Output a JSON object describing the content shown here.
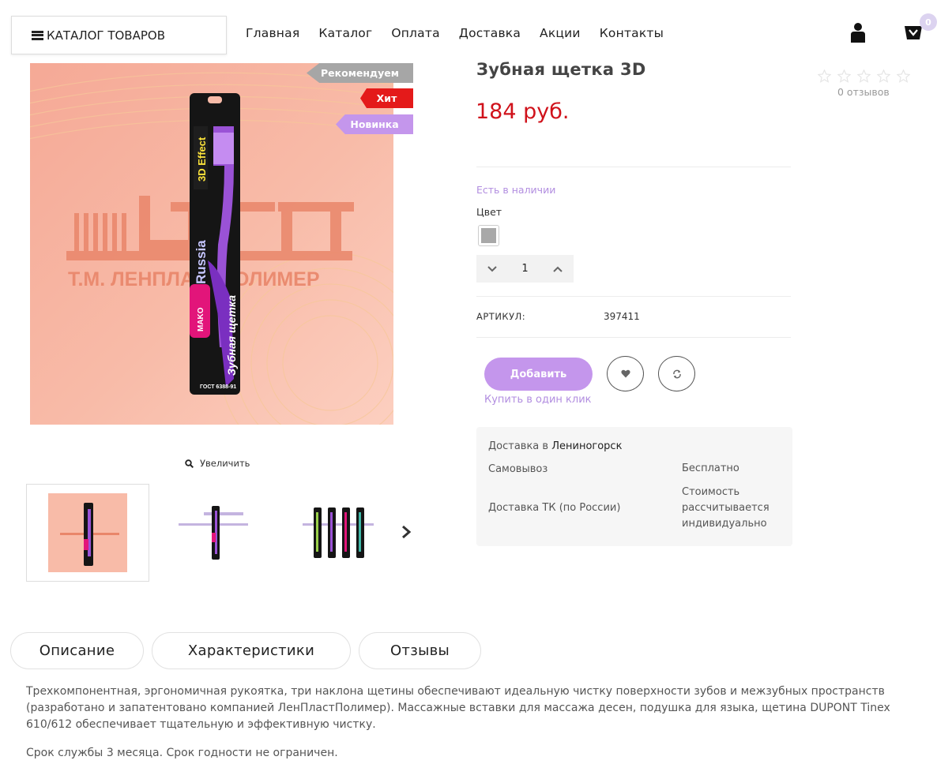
{
  "header": {
    "catalog_button": "КАТАЛОГ ТОВАРОВ",
    "nav": [
      "Главная",
      "Каталог",
      "Оплата",
      "Доставка",
      "Акции",
      "Контакты"
    ],
    "cart_count": "0"
  },
  "product": {
    "title": "Зубная щетка 3D",
    "price": "184 руб.",
    "badges": {
      "recommend": "Рекомендуем",
      "hit": "Хит",
      "new": "Новинка"
    },
    "reviews": "0 отзывов",
    "rating": 0,
    "stock": "Есть в наличии",
    "color_label": "Цвет",
    "quantity": "1",
    "sku_label": "АРТИКУЛ:",
    "sku": "397411",
    "add_button": "Добавить",
    "one_click": "Купить в один клик",
    "zoom": "Увеличить",
    "image": {
      "logo_text": "ЛП",
      "brand_text": "Т.М. ЛЕНПЛАСТПОЛИМЕР",
      "pack_3d": "3D Effect",
      "pack_russia": "Russia",
      "pack_name": "Зубная щетка",
      "pack_mako": "MAKO",
      "pack_gost": "ГОСТ 6388-91"
    }
  },
  "delivery": {
    "title_prefix": "Доставка в",
    "city": "Лениногорск",
    "rows": [
      {
        "name": "Самовывоз",
        "value": "Бесплатно"
      },
      {
        "name": "Доставка ТК (по России)",
        "value": "Стоимость рассчитывается индивидуально"
      }
    ]
  },
  "tabs": [
    "Описание",
    "Характеристики",
    "Отзывы"
  ],
  "description": {
    "p1": "Трехкомпонентная, эргономичная рукоятка, три наклона щетины обеспечивают идеальную чистку поверхности зубов и межзубных пространств (разработано и запатентовано компанией ЛенПластПолимер). Массажные вставки для массажа десен, подушка для языка, щетина DUPONT Tinex 610/612 обеспечивает тщательную и эффективную чистку.",
    "p2": "Срок службы 3 месяца. Срок годности не ограничен."
  },
  "colors": {
    "accent": "#c496ec",
    "price": "#d0121b",
    "hit": "#e41a1a",
    "recommend": "#a6a6a6",
    "swatch": "#a8a8a8"
  },
  "icons": [
    "list-icon",
    "user-icon",
    "cart-icon",
    "search-icon",
    "chevron-down-icon",
    "chevron-up-icon",
    "heart-icon",
    "compare-icon",
    "chevron-right-icon",
    "star-icon"
  ]
}
